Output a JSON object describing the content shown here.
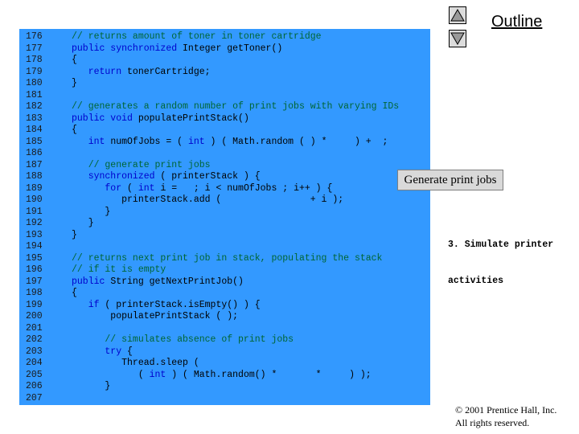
{
  "outline": {
    "title": "Outline"
  },
  "navigation": {
    "up_icon": "triangle-up",
    "down_icon": "triangle-down"
  },
  "code": {
    "line_numbers": [
      "176",
      "177",
      "178",
      "179",
      "180",
      "181",
      "182",
      "183",
      "184",
      "185",
      "186",
      "187",
      "188",
      "189",
      "190",
      "191",
      "192",
      "193",
      "194",
      "195",
      "196",
      "197",
      "198",
      "199",
      "200",
      "201",
      "202",
      "203",
      "204",
      "205",
      "206",
      "207"
    ],
    "lines": [
      [
        {
          "t": "// returns amount of toner in toner cartridge",
          "c": "comment"
        }
      ],
      [
        {
          "t": "public synchronized ",
          "c": "kw"
        },
        {
          "t": "Integer getToner()",
          "c": "plain"
        }
      ],
      [
        {
          "t": "{",
          "c": "plain"
        }
      ],
      [
        {
          "t": "   return ",
          "c": "kw"
        },
        {
          "t": "tonerCartridge;",
          "c": "plain"
        }
      ],
      [
        {
          "t": "}",
          "c": "plain"
        }
      ],
      [],
      [
        {
          "t": "// generates a random number of print jobs with varying IDs",
          "c": "comment"
        }
      ],
      [
        {
          "t": "public void ",
          "c": "kw"
        },
        {
          "t": "populatePrintStack()",
          "c": "plain"
        }
      ],
      [
        {
          "t": "{",
          "c": "plain"
        }
      ],
      [
        {
          "t": "   int ",
          "c": "kw"
        },
        {
          "t": "numOfJobs = ( ",
          "c": "plain"
        },
        {
          "t": "int ",
          "c": "kw"
        },
        {
          "t": ") ( Math.random ( ) *     ) +  ;",
          "c": "plain"
        }
      ],
      [],
      [
        {
          "t": "   // generate print jobs",
          "c": "comment"
        }
      ],
      [
        {
          "t": "   synchronized ",
          "c": "kw"
        },
        {
          "t": "( printerStack ) {",
          "c": "plain"
        }
      ],
      [
        {
          "t": "      for ",
          "c": "kw"
        },
        {
          "t": "( ",
          "c": "plain"
        },
        {
          "t": "int ",
          "c": "kw"
        },
        {
          "t": "i =   ; i < numOfJobs ; i++ ) {",
          "c": "plain"
        }
      ],
      [
        {
          "t": "         printerStack.add (                + i );",
          "c": "plain"
        }
      ],
      [
        {
          "t": "      }",
          "c": "plain"
        }
      ],
      [
        {
          "t": "   }",
          "c": "plain"
        }
      ],
      [
        {
          "t": "}",
          "c": "plain"
        }
      ],
      [],
      [
        {
          "t": "// returns next print job in stack, populating the stack",
          "c": "comment"
        }
      ],
      [
        {
          "t": "// if it is empty",
          "c": "comment"
        }
      ],
      [
        {
          "t": "public ",
          "c": "kw"
        },
        {
          "t": "String getNextPrintJob()",
          "c": "plain"
        }
      ],
      [
        {
          "t": "{",
          "c": "plain"
        }
      ],
      [
        {
          "t": "   if ",
          "c": "kw"
        },
        {
          "t": "( printerStack.isEmpty() ) {",
          "c": "plain"
        }
      ],
      [
        {
          "t": "       populatePrintStack ( );",
          "c": "plain"
        }
      ],
      [],
      [
        {
          "t": "      // simulates absence of print jobs",
          "c": "comment"
        }
      ],
      [
        {
          "t": "      try ",
          "c": "kw"
        },
        {
          "t": "{",
          "c": "plain"
        }
      ],
      [
        {
          "t": "         Thread.sleep (",
          "c": "plain"
        }
      ],
      [
        {
          "t": "            ( ",
          "c": "plain"
        },
        {
          "t": "int ",
          "c": "kw"
        },
        {
          "t": ") ( Math.random() *       *     ) );",
          "c": "plain"
        }
      ],
      [
        {
          "t": "      }",
          "c": "plain"
        }
      ],
      []
    ]
  },
  "callout": {
    "text": "Generate print jobs"
  },
  "note": {
    "lines": [
      "3. Simulate printer",
      "activities"
    ]
  },
  "copyright": {
    "lines": [
      "© 2001 Prentice Hall, Inc.",
      "All rights reserved."
    ]
  }
}
